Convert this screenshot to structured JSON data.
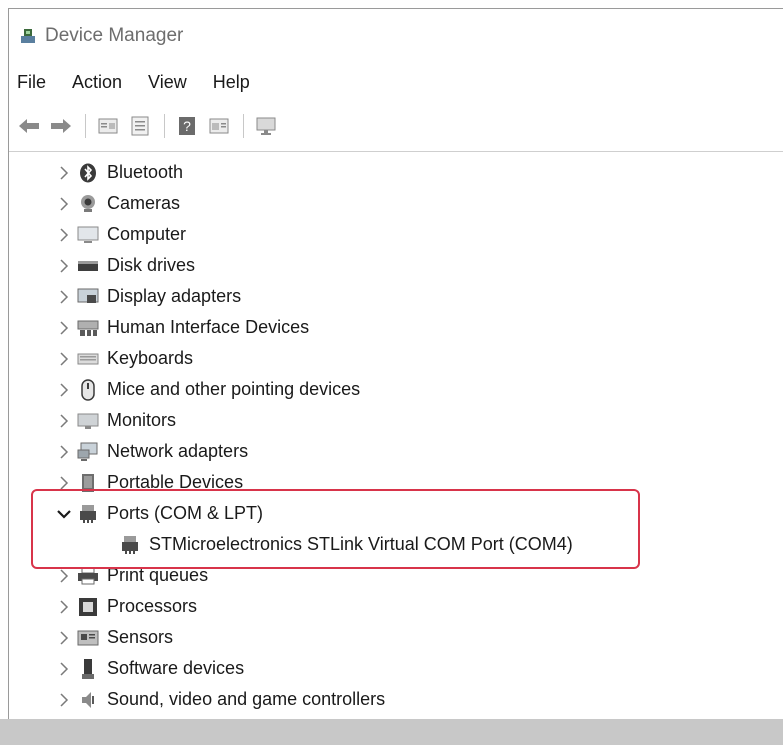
{
  "window": {
    "title": "Device Manager"
  },
  "menu": [
    "File",
    "Action",
    "View",
    "Help"
  ],
  "toolbar": {
    "buttons": [
      "back-arrow-icon",
      "forward-arrow-icon",
      "properties-icon",
      "driver-icon",
      "help-icon",
      "view-icon",
      "monitor-icon"
    ]
  },
  "tree": {
    "nodes": [
      {
        "label": "Bluetooth",
        "icon": "bluetooth-icon",
        "expanded": false
      },
      {
        "label": "Cameras",
        "icon": "camera-icon",
        "expanded": false
      },
      {
        "label": "Computer",
        "icon": "computer-icon",
        "expanded": false
      },
      {
        "label": "Disk drives",
        "icon": "disk-drive-icon",
        "expanded": false
      },
      {
        "label": "Display adapters",
        "icon": "display-adapter-icon",
        "expanded": false
      },
      {
        "label": "Human Interface Devices",
        "icon": "hid-icon",
        "expanded": false
      },
      {
        "label": "Keyboards",
        "icon": "keyboard-icon",
        "expanded": false
      },
      {
        "label": "Mice and other pointing devices",
        "icon": "mouse-icon",
        "expanded": false
      },
      {
        "label": "Monitors",
        "icon": "monitor-icon",
        "expanded": false
      },
      {
        "label": "Network adapters",
        "icon": "network-adapter-icon",
        "expanded": false
      },
      {
        "label": "Portable Devices",
        "icon": "portable-device-icon",
        "expanded": false
      },
      {
        "label": "Ports (COM & LPT)",
        "icon": "port-icon",
        "expanded": true
      },
      {
        "label": "STMicroelectronics STLink Virtual COM Port (COM4)",
        "icon": "port-icon",
        "child": true
      },
      {
        "label": "Print queues",
        "icon": "printer-icon",
        "expanded": false
      },
      {
        "label": "Processors",
        "icon": "processor-icon",
        "expanded": false
      },
      {
        "label": "Sensors",
        "icon": "sensor-icon",
        "expanded": false
      },
      {
        "label": "Software devices",
        "icon": "software-device-icon",
        "expanded": false
      },
      {
        "label": "Sound, video and game controllers",
        "icon": "sound-icon",
        "expanded": false
      }
    ]
  },
  "highlight_color": "#d8344a"
}
